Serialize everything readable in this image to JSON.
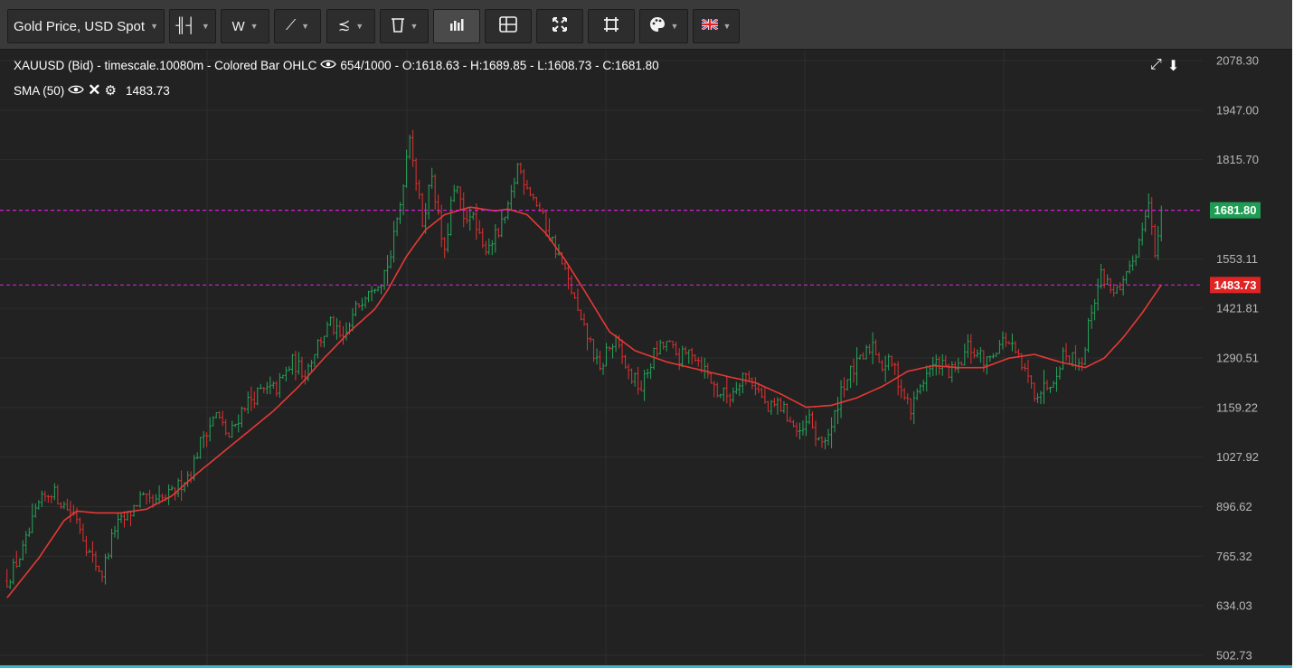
{
  "toolbar": {
    "instrument_label": "Gold Price, USD Spot",
    "timeframe_label": "W",
    "buttons": [
      {
        "name": "chart-type-button",
        "icon": "ohlc-bars-icon",
        "glyph": "╢┤"
      },
      {
        "name": "drawing-tools-button",
        "icon": "trend-line-icon",
        "glyph": "⟋"
      },
      {
        "name": "indicators-button",
        "icon": "indicator-icon",
        "glyph": "≾"
      },
      {
        "name": "delete-button",
        "icon": "trash-icon",
        "glyph": "🗑"
      },
      {
        "name": "volume-toggle-button",
        "icon": "bar-chart-icon",
        "glyph": "ıl"
      },
      {
        "name": "layout-button",
        "icon": "layout-grid-icon",
        "glyph": "⊞"
      },
      {
        "name": "fullscreen-button",
        "icon": "expand-arrows-icon",
        "glyph": "⤧"
      },
      {
        "name": "fit-button",
        "icon": "frame-icon",
        "glyph": "⌗"
      },
      {
        "name": "theme-button",
        "icon": "palette-icon",
        "glyph": "🎨"
      },
      {
        "name": "language-button",
        "icon": "uk-flag-icon",
        "glyph": "🇬🇧"
      }
    ]
  },
  "legend": {
    "series_title": "XAUUSD (Bid) - timescale.10080m - Colored Bar OHLC",
    "bar_count": "654/1000",
    "ohlc": "- O:1618.63 - H:1689.85 - L:1608.73 - C:1681.80",
    "sma_label": "SMA (50)",
    "sma_value": "1483.73"
  },
  "top_right_icons": {
    "expand": "⤢",
    "download": "⬇"
  },
  "chart_data": {
    "type": "ohlc",
    "title": "XAUUSD (Bid) - timescale.10080m - Colored Bar OHLC",
    "ylim": [
      502.73,
      2078.3
    ],
    "y_ticks": [
      "2078.30",
      "1947.00",
      "1815.70",
      "1553.11",
      "1421.81",
      "1290.51",
      "1159.22",
      "1027.92",
      "896.62",
      "765.32",
      "634.03",
      "502.73"
    ],
    "price_anchors": [
      [
        0,
        700
      ],
      [
        5,
        780
      ],
      [
        10,
        900
      ],
      [
        14,
        940
      ],
      [
        18,
        900
      ],
      [
        22,
        870
      ],
      [
        26,
        770
      ],
      [
        30,
        720
      ],
      [
        34,
        840
      ],
      [
        38,
        870
      ],
      [
        42,
        920
      ],
      [
        46,
        900
      ],
      [
        52,
        930
      ],
      [
        58,
        990
      ],
      [
        62,
        1090
      ],
      [
        66,
        1140
      ],
      [
        70,
        1080
      ],
      [
        75,
        1170
      ],
      [
        80,
        1200
      ],
      [
        85,
        1210
      ],
      [
        90,
        1280
      ],
      [
        94,
        1250
      ],
      [
        98,
        1330
      ],
      [
        102,
        1380
      ],
      [
        106,
        1330
      ],
      [
        110,
        1420
      ],
      [
        114,
        1480
      ],
      [
        118,
        1500
      ],
      [
        121,
        1560
      ],
      [
        124,
        1700
      ],
      [
        127,
        1890
      ],
      [
        129,
        1760
      ],
      [
        131,
        1650
      ],
      [
        134,
        1780
      ],
      [
        136,
        1660
      ],
      [
        138,
        1560
      ],
      [
        140,
        1700
      ],
      [
        142,
        1740
      ],
      [
        144,
        1650
      ],
      [
        146,
        1680
      ],
      [
        150,
        1580
      ],
      [
        155,
        1620
      ],
      [
        158,
        1680
      ],
      [
        161,
        1800
      ],
      [
        164,
        1750
      ],
      [
        167,
        1700
      ],
      [
        170,
        1640
      ],
      [
        174,
        1560
      ],
      [
        178,
        1470
      ],
      [
        181,
        1380
      ],
      [
        184,
        1330
      ],
      [
        187,
        1250
      ],
      [
        189,
        1310
      ],
      [
        192,
        1330
      ],
      [
        196,
        1250
      ],
      [
        200,
        1210
      ],
      [
        204,
        1300
      ],
      [
        208,
        1330
      ],
      [
        212,
        1290
      ],
      [
        216,
        1310
      ],
      [
        220,
        1260
      ],
      [
        224,
        1200
      ],
      [
        228,
        1190
      ],
      [
        232,
        1250
      ],
      [
        236,
        1220
      ],
      [
        240,
        1150
      ],
      [
        243,
        1170
      ],
      [
        246,
        1140
      ],
      [
        250,
        1080
      ],
      [
        253,
        1130
      ],
      [
        256,
        1060
      ],
      [
        260,
        1100
      ],
      [
        263,
        1210
      ],
      [
        266,
        1250
      ],
      [
        270,
        1290
      ],
      [
        273,
        1330
      ],
      [
        276,
        1270
      ],
      [
        279,
        1280
      ],
      [
        282,
        1210
      ],
      [
        285,
        1150
      ],
      [
        288,
        1220
      ],
      [
        291,
        1260
      ],
      [
        294,
        1280
      ],
      [
        297,
        1250
      ],
      [
        300,
        1260
      ],
      [
        303,
        1320
      ],
      [
        306,
        1300
      ],
      [
        309,
        1280
      ],
      [
        312,
        1320
      ],
      [
        315,
        1340
      ],
      [
        318,
        1300
      ],
      [
        321,
        1250
      ],
      [
        324,
        1200
      ],
      [
        327,
        1210
      ],
      [
        330,
        1240
      ],
      [
        333,
        1300
      ],
      [
        336,
        1290
      ],
      [
        339,
        1280
      ],
      [
        342,
        1420
      ],
      [
        345,
        1510
      ],
      [
        348,
        1480
      ],
      [
        351,
        1460
      ],
      [
        354,
        1520
      ],
      [
        357,
        1600
      ],
      [
        360,
        1720
      ],
      [
        362,
        1550
      ],
      [
        364,
        1681.8
      ]
    ],
    "bars_total": 365,
    "sma": {
      "period": 50,
      "anchors": [
        [
          0,
          655
        ],
        [
          10,
          760
        ],
        [
          18,
          860
        ],
        [
          22,
          885
        ],
        [
          28,
          880
        ],
        [
          36,
          880
        ],
        [
          44,
          890
        ],
        [
          52,
          925
        ],
        [
          60,
          985
        ],
        [
          68,
          1040
        ],
        [
          76,
          1095
        ],
        [
          84,
          1150
        ],
        [
          92,
          1215
        ],
        [
          100,
          1290
        ],
        [
          108,
          1360
        ],
        [
          116,
          1420
        ],
        [
          120,
          1470
        ],
        [
          126,
          1560
        ],
        [
          132,
          1630
        ],
        [
          138,
          1670
        ],
        [
          146,
          1690
        ],
        [
          154,
          1680
        ],
        [
          158,
          1685
        ],
        [
          164,
          1670
        ],
        [
          170,
          1620
        ],
        [
          176,
          1550
        ],
        [
          182,
          1470
        ],
        [
          190,
          1360
        ],
        [
          198,
          1310
        ],
        [
          208,
          1280
        ],
        [
          218,
          1260
        ],
        [
          228,
          1240
        ],
        [
          236,
          1225
        ],
        [
          244,
          1195
        ],
        [
          252,
          1160
        ],
        [
          260,
          1165
        ],
        [
          268,
          1185
        ],
        [
          276,
          1215
        ],
        [
          284,
          1255
        ],
        [
          292,
          1270
        ],
        [
          300,
          1265
        ],
        [
          308,
          1265
        ],
        [
          316,
          1290
        ],
        [
          324,
          1300
        ],
        [
          332,
          1280
        ],
        [
          340,
          1265
        ],
        [
          346,
          1290
        ],
        [
          352,
          1345
        ],
        [
          358,
          1410
        ],
        [
          364,
          1483.73
        ]
      ]
    },
    "series": [
      {
        "name": "XAUUSD (Bid)",
        "up_color": "#26a65b",
        "down_color": "#e03131"
      },
      {
        "name": "SMA (50)",
        "color": "#e53935",
        "value": 1483.73
      }
    ],
    "horizontal_lines": [
      {
        "value": 1681.8,
        "label": "1681.80",
        "label_color": "#1f9d55",
        "line_color": "#d11fd1"
      },
      {
        "value": 1483.73,
        "label": "1483.73",
        "label_color": "#e02424",
        "line_color": "#d11fd1"
      }
    ],
    "grid": true,
    "last_close": 1681.8
  }
}
